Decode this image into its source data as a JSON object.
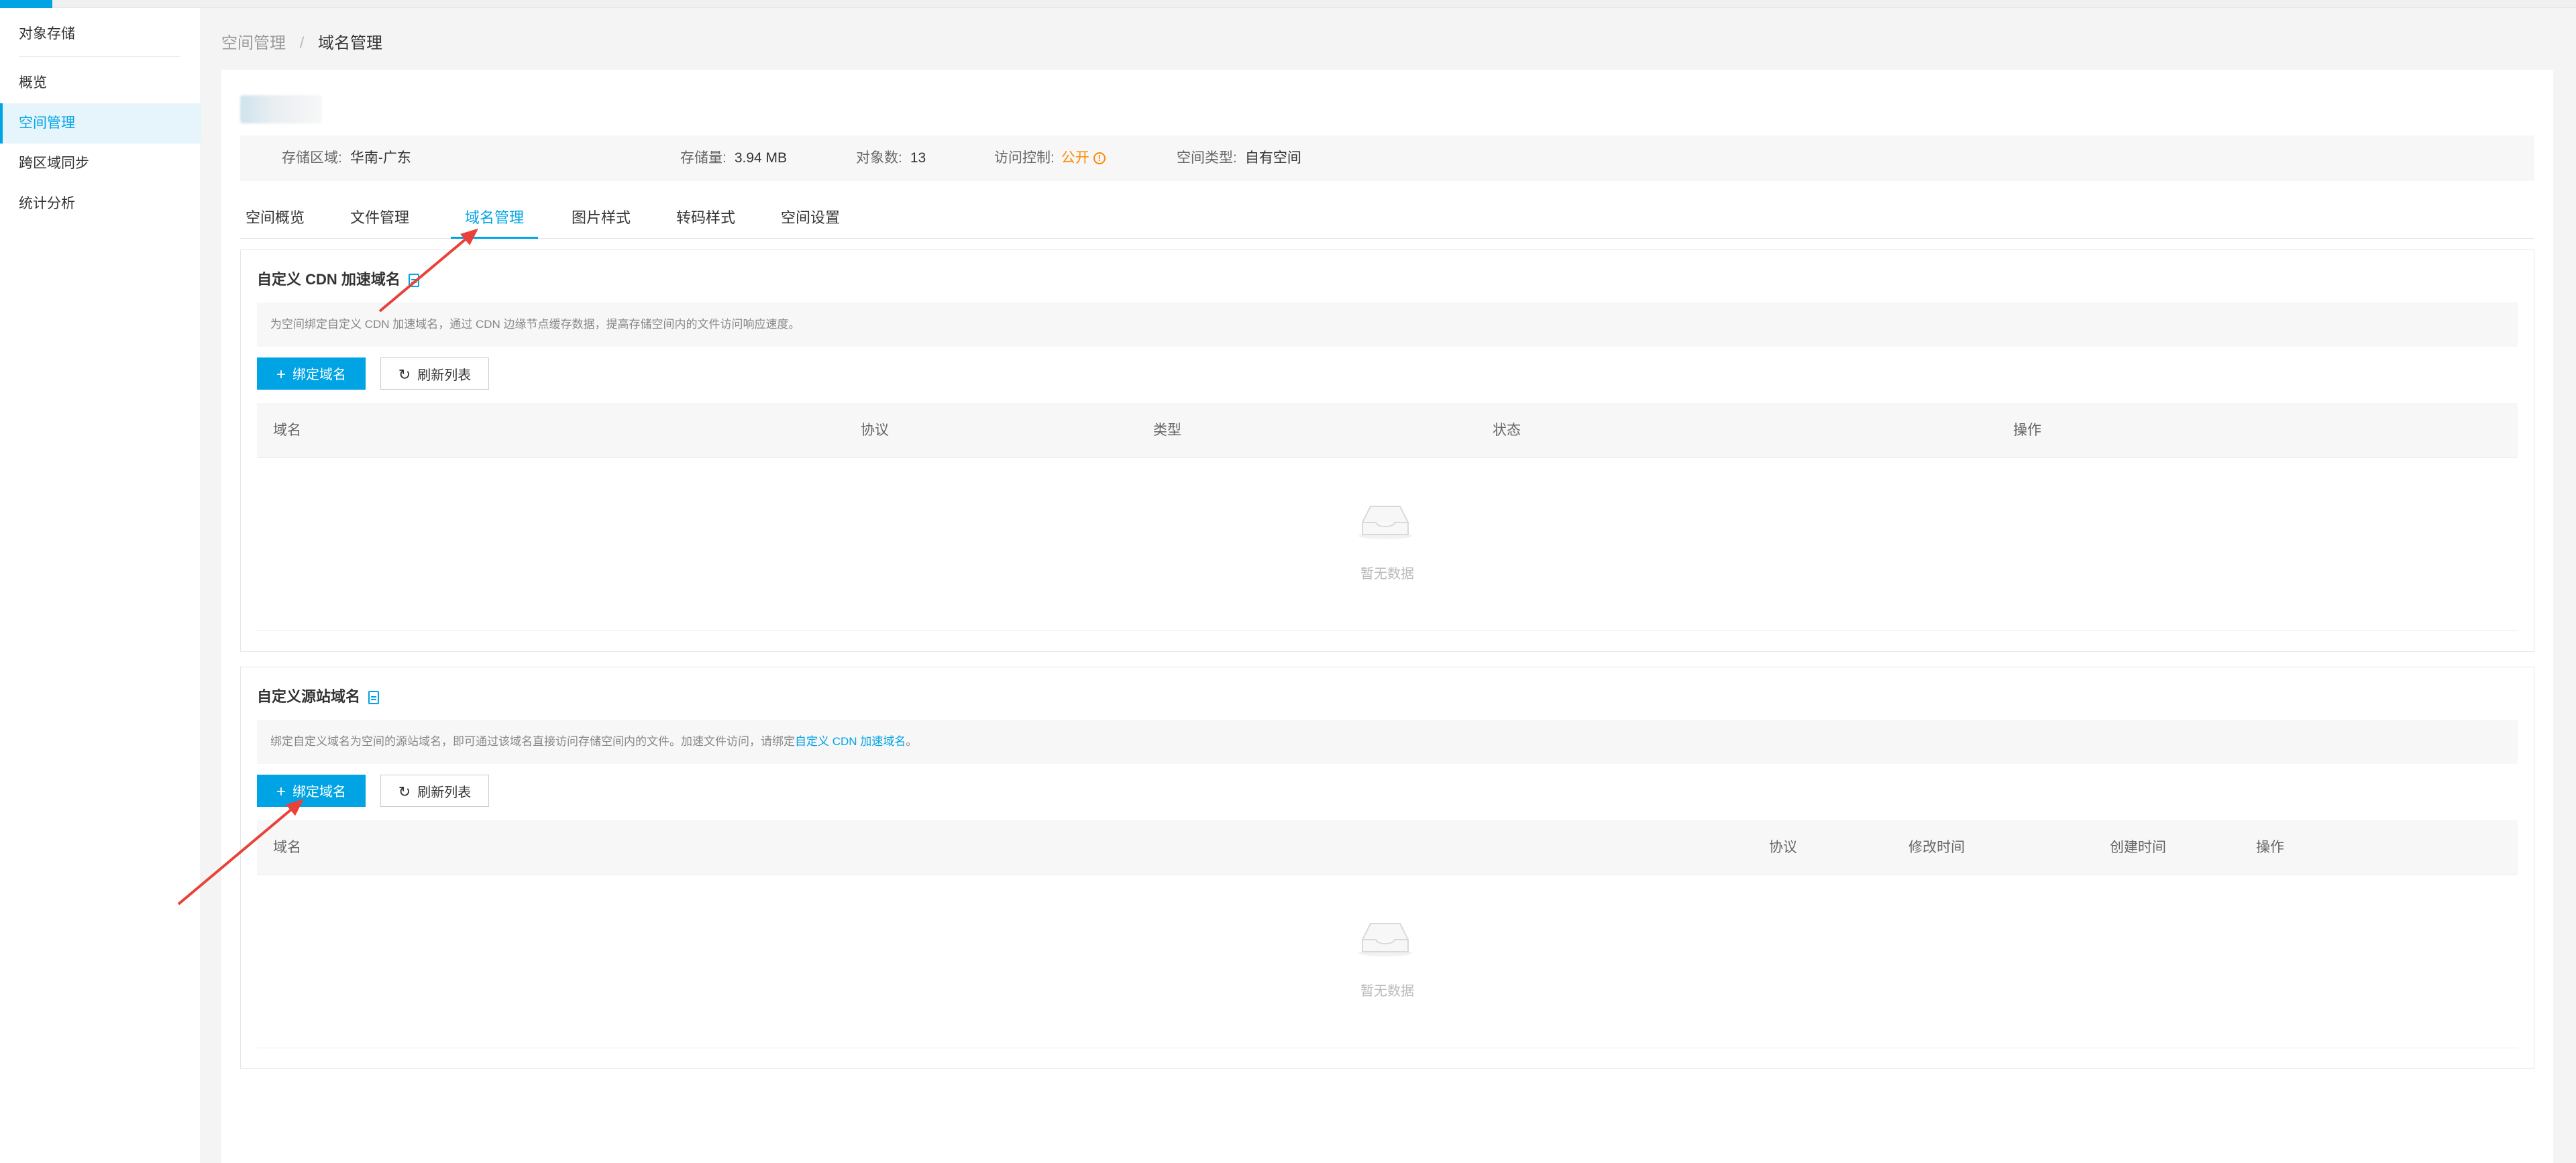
{
  "sidebar": {
    "title": "对象存储",
    "items": [
      {
        "label": "概览"
      },
      {
        "label": "空间管理",
        "active": true
      },
      {
        "label": "跨区域同步"
      },
      {
        "label": "统计分析"
      }
    ]
  },
  "breadcrumb": {
    "parent": "空间管理",
    "separator": "/",
    "current": "域名管理"
  },
  "info": {
    "region_label": "存储区域:",
    "region_value": "华南-广东",
    "storage_label": "存储量:",
    "storage_value": "3.94 MB",
    "objects_label": "对象数:",
    "objects_value": "13",
    "access_label": "访问控制:",
    "access_value": "公开",
    "type_label": "空间类型:",
    "type_value": "自有空间"
  },
  "tabs": [
    {
      "label": "空间概览"
    },
    {
      "label": "文件管理"
    },
    {
      "label": "域名管理",
      "active": true
    },
    {
      "label": "图片样式"
    },
    {
      "label": "转码样式"
    },
    {
      "label": "空间设置"
    }
  ],
  "cdn_section": {
    "title": "自定义 CDN 加速域名",
    "tip": "为空间绑定自定义 CDN 加速域名，通过 CDN 边缘节点缓存数据，提高存储空间内的文件访问响应速度。",
    "bind_button": "绑定域名",
    "refresh_button": "刷新列表",
    "columns": [
      "域名",
      "协议",
      "类型",
      "状态",
      "操作"
    ],
    "empty_text": "暂无数据"
  },
  "origin_section": {
    "title": "自定义源站域名",
    "tip_prefix": "绑定自定义域名为空间的源站域名，即可通过该域名直接访问存储空间内的文件。加速文件访问，请绑定",
    "tip_link": "自定义 CDN 加速域名",
    "tip_suffix": "。",
    "bind_button": "绑定域名",
    "refresh_button": "刷新列表",
    "columns": [
      "域名",
      "协议",
      "修改时间",
      "创建时间",
      "操作"
    ],
    "empty_text": "暂无数据"
  },
  "colors": {
    "accent": "#00a4e4",
    "warning": "#ff8a00",
    "annotation": "#e8423a"
  },
  "icons": {
    "doc": "doc-icon",
    "plus": "plus-icon",
    "refresh": "refresh-icon",
    "empty": "empty-inbox-icon",
    "warning": "warning-icon"
  }
}
